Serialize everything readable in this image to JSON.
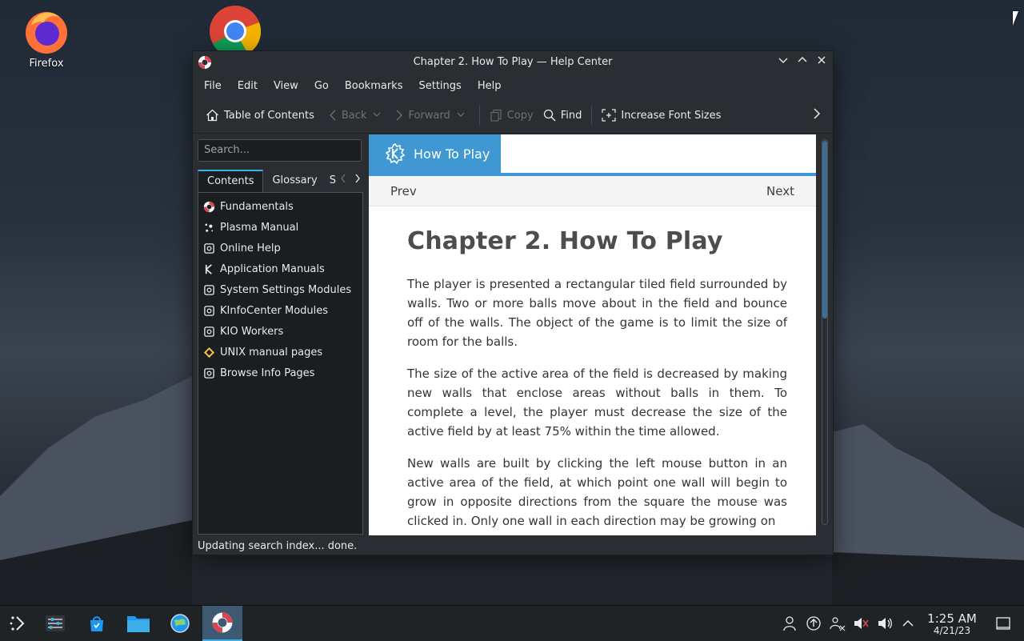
{
  "desktop": {
    "icons": [
      {
        "label": "Firefox"
      }
    ],
    "chrome_icon": "chrome-icon"
  },
  "window": {
    "title": "Chapter 2. How To Play — Help Center",
    "menu": [
      "File",
      "Edit",
      "View",
      "Go",
      "Bookmarks",
      "Settings",
      "Help"
    ],
    "toolbar": {
      "toc": "Table of Contents",
      "back": "Back",
      "forward": "Forward",
      "copy": "Copy",
      "find": "Find",
      "font": "Increase Font Sizes"
    },
    "sidebar": {
      "search_placeholder": "Search...",
      "tabs": [
        "Contents",
        "Glossary",
        "S"
      ],
      "items": [
        {
          "label": "Fundamentals",
          "icon": "lifebuoy-icon"
        },
        {
          "label": "Plasma Manual",
          "icon": "plasma-icon"
        },
        {
          "label": "Online Help",
          "icon": "module-icon"
        },
        {
          "label": "Application Manuals",
          "icon": "kde-icon"
        },
        {
          "label": "System Settings Modules",
          "icon": "module-icon"
        },
        {
          "label": "KInfoCenter Modules",
          "icon": "module-icon"
        },
        {
          "label": "KIO Workers",
          "icon": "module-icon"
        },
        {
          "label": "UNIX manual pages",
          "icon": "diamond-icon"
        },
        {
          "label": "Browse Info Pages",
          "icon": "module-icon"
        }
      ]
    },
    "content": {
      "header_tab": "How To Play",
      "prev": "Prev",
      "next": "Next",
      "heading": "Chapter 2. How To Play",
      "paragraphs": [
        "The player is presented a rectangular tiled field surrounded by walls. Two or more balls move about in the field and bounce off of the walls. The object of the game is to limit the size of room for the balls.",
        "The size of the active area of the field is decreased by making new walls that enclose areas without balls in them. To complete a level, the player must decrease the size of the active field by at least 75% within the time allowed.",
        "New walls are built by clicking the  left mouse button in an active area of the field, at which point one wall will begin to grow in opposite directions from the square the mouse was clicked in. Only one wall in each direction may be growing on"
      ]
    },
    "status": "Updating search index... done."
  },
  "taskbar": {
    "time": "1:25 AM",
    "date": "4/21/23"
  }
}
